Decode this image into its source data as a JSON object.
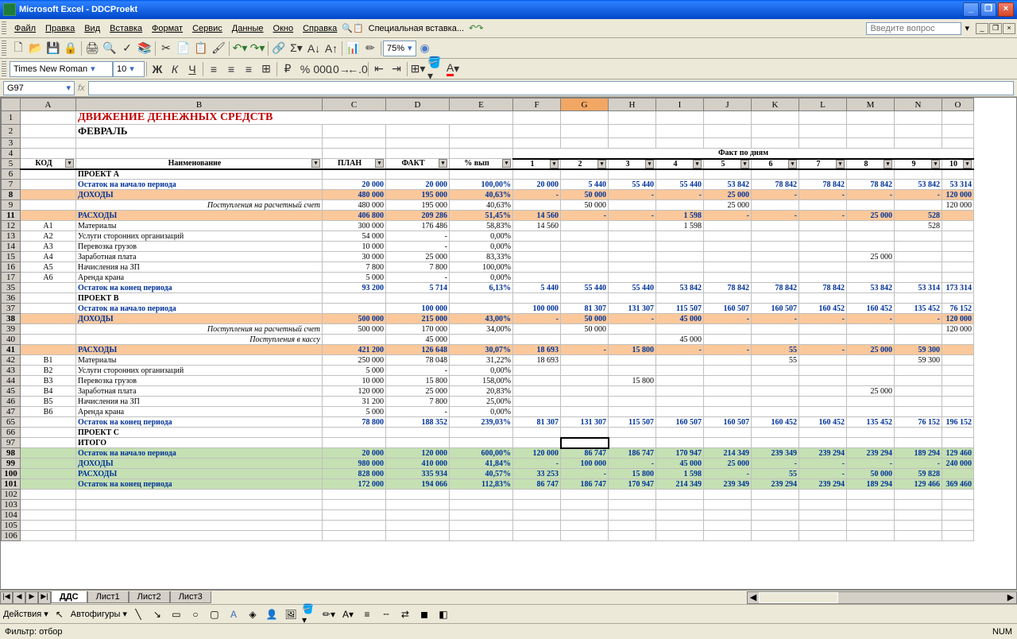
{
  "app": {
    "title": "Microsoft Excel - DDCProekt"
  },
  "menu": {
    "items": [
      "Файл",
      "Правка",
      "Вид",
      "Вставка",
      "Формат",
      "Сервис",
      "Данные",
      "Окно",
      "Справка"
    ],
    "extra": "Специальная вставка...",
    "help_placeholder": "Введите вопрос"
  },
  "font": {
    "name": "Times New Roman",
    "size": "10"
  },
  "zoom": "75%",
  "namebox": "G97",
  "cols": [
    "A",
    "B",
    "C",
    "D",
    "E",
    "F",
    "G",
    "H",
    "I",
    "J",
    "K",
    "L",
    "M",
    "N",
    "O"
  ],
  "doc": {
    "title": "ДВИЖЕНИЕ ДЕНЕЖНЫХ СРЕДСТВ",
    "month": "ФЕВРАЛЬ",
    "fakt_header": "Факт по дням",
    "hdr": {
      "code": "КОД",
      "name": "Наименование",
      "plan": "ПЛАН",
      "fact": "ФАКТ",
      "pct": "% вып"
    },
    "days": [
      "1",
      "2",
      "3",
      "4",
      "5",
      "6",
      "7",
      "8",
      "9",
      "10"
    ]
  },
  "rows": [
    {
      "n": "6",
      "type": "section",
      "label": "ПРОЕКТ А"
    },
    {
      "n": "7",
      "type": "blue",
      "label": "Остаток на начало периода",
      "c": "20 000",
      "d": "20 000",
      "e": "100,00%",
      "f": "20 000",
      "g": "5 440",
      "h": "55 440",
      "i": "55 440",
      "j": "53 842",
      "k": "78 842",
      "l": "78 842",
      "m": "78 842",
      "n2": "53 842",
      "o": "53 314"
    },
    {
      "n": "8",
      "type": "orange",
      "label": "ДОХОДЫ",
      "c": "480 000",
      "d": "195 000",
      "e": "40,63%",
      "f": "-",
      "g": "50 000",
      "h": "-",
      "i": "-",
      "j": "25 000",
      "k": "-",
      "l": "-",
      "m": "-",
      "n2": "-",
      "o": "120 000"
    },
    {
      "n": "9",
      "type": "italic",
      "label": "Поступления на расчетный счет",
      "c": "480 000",
      "d": "195 000",
      "e": "40,63%",
      "g": "50 000",
      "j": "25 000",
      "o": "120 000"
    },
    {
      "n": "11",
      "type": "orange",
      "label": "РАСХОДЫ",
      "c": "406 800",
      "d": "209 286",
      "e": "51,45%",
      "f": "14 560",
      "g": "-",
      "h": "-",
      "i": "1 598",
      "j": "-",
      "k": "-",
      "l": "-",
      "m": "25 000",
      "n2": "528"
    },
    {
      "n": "12",
      "code": "А1",
      "label": "Материалы",
      "c": "300 000",
      "d": "176 486",
      "e": "58,83%",
      "f": "14 560",
      "i": "1 598",
      "n2": "528"
    },
    {
      "n": "13",
      "code": "А2",
      "label": "Услуги сторонних организаций",
      "c": "54 000",
      "d": "-",
      "e": "0,00%"
    },
    {
      "n": "14",
      "code": "А3",
      "label": "Перевозка грузов",
      "c": "10 000",
      "d": "-",
      "e": "0,00%"
    },
    {
      "n": "15",
      "code": "А4",
      "label": "Заработная плата",
      "c": "30 000",
      "d": "25 000",
      "e": "83,33%",
      "m": "25 000"
    },
    {
      "n": "16",
      "code": "А5",
      "label": "Начисления на ЗП",
      "c": "7 800",
      "d": "7 800",
      "e": "100,00%"
    },
    {
      "n": "17",
      "code": "А6",
      "label": "Аренда крана",
      "c": "5 000",
      "d": "-",
      "e": "0,00%"
    },
    {
      "n": "35",
      "type": "blue",
      "label": "Остаток на конец периода",
      "c": "93 200",
      "d": "5 714",
      "e": "6,13%",
      "f": "5 440",
      "g": "55 440",
      "h": "55 440",
      "i": "53 842",
      "j": "78 842",
      "k": "78 842",
      "l": "78 842",
      "m": "53 842",
      "n2": "53 314",
      "o": "173 314"
    },
    {
      "n": "36",
      "type": "section",
      "label": "ПРОЕКТ В"
    },
    {
      "n": "37",
      "type": "blue",
      "label": "Остаток на начало периода",
      "d": "100 000",
      "f": "100 000",
      "g": "81 307",
      "h": "131 307",
      "i": "115 507",
      "j": "160 507",
      "k": "160 507",
      "l": "160 452",
      "m": "160 452",
      "n2": "135 452",
      "o": "76 152"
    },
    {
      "n": "38",
      "type": "orange",
      "label": "ДОХОДЫ",
      "c": "500 000",
      "d": "215 000",
      "e": "43,00%",
      "f": "-",
      "g": "50 000",
      "h": "-",
      "i": "45 000",
      "j": "-",
      "k": "-",
      "l": "-",
      "m": "-",
      "n2": "-",
      "o": "120 000"
    },
    {
      "n": "39",
      "type": "italic",
      "label": "Поступления на расчетный счет",
      "c": "500 000",
      "d": "170 000",
      "e": "34,00%",
      "g": "50 000",
      "o": "120 000"
    },
    {
      "n": "40",
      "type": "italic",
      "label": "Поступления в кассу",
      "d": "45 000",
      "i": "45 000"
    },
    {
      "n": "41",
      "type": "orange",
      "label": "РАСХОДЫ",
      "c": "421 200",
      "d": "126 648",
      "e": "30,07%",
      "f": "18 693",
      "g": "-",
      "h": "15 800",
      "i": "-",
      "j": "-",
      "k": "55",
      "l": "-",
      "m": "25 000",
      "n2": "59 300"
    },
    {
      "n": "42",
      "code": "В1",
      "label": "Материалы",
      "c": "250 000",
      "d": "78 048",
      "e": "31,22%",
      "f": "18 693",
      "k": "55",
      "n2": "59 300"
    },
    {
      "n": "43",
      "code": "В2",
      "label": "Услуги сторонних организаций",
      "c": "5 000",
      "d": "-",
      "e": "0,00%"
    },
    {
      "n": "44",
      "code": "В3",
      "label": "Перевозка грузов",
      "c": "10 000",
      "d": "15 800",
      "e": "158,00%",
      "h": "15 800"
    },
    {
      "n": "45",
      "code": "В4",
      "label": "Заработная плата",
      "c": "120 000",
      "d": "25 000",
      "e": "20,83%",
      "m": "25 000"
    },
    {
      "n": "46",
      "code": "В5",
      "label": "Начисления на ЗП",
      "c": "31 200",
      "d": "7 800",
      "e": "25,00%"
    },
    {
      "n": "47",
      "code": "В6",
      "label": "Аренда крана",
      "c": "5 000",
      "d": "-",
      "e": "0,00%"
    },
    {
      "n": "65",
      "type": "blue",
      "label": "Остаток на конец периода",
      "c": "78 800",
      "d": "188 352",
      "e": "239,03%",
      "f": "81 307",
      "g": "131 307",
      "h": "115 507",
      "i": "160 507",
      "j": "160 507",
      "k": "160 452",
      "l": "160 452",
      "m": "135 452",
      "n2": "76 152",
      "o": "196 152"
    },
    {
      "n": "66",
      "type": "section",
      "label": "ПРОЕКТ С"
    },
    {
      "n": "97",
      "type": "section",
      "label": "ИТОГО",
      "selected": true
    },
    {
      "n": "98",
      "type": "green",
      "label": "Остаток на начало периода",
      "c": "20 000",
      "d": "120 000",
      "e": "600,00%",
      "f": "120 000",
      "g": "86 747",
      "h": "186 747",
      "i": "170 947",
      "j": "214 349",
      "k": "239 349",
      "l": "239 294",
      "m": "239 294",
      "n2": "189 294",
      "o": "129 460"
    },
    {
      "n": "99",
      "type": "green",
      "label": "ДОХОДЫ",
      "c": "980 000",
      "d": "410 000",
      "e": "41,84%",
      "f": "-",
      "g": "100 000",
      "h": "-",
      "i": "45 000",
      "j": "25 000",
      "k": "-",
      "l": "-",
      "m": "-",
      "n2": "-",
      "o": "240 000"
    },
    {
      "n": "100",
      "type": "green",
      "label": "РАСХОДЫ",
      "c": "828 000",
      "d": "335 934",
      "e": "40,57%",
      "f": "33 253",
      "g": "-",
      "h": "15 800",
      "i": "1 598",
      "j": "-",
      "k": "55",
      "l": "-",
      "m": "50 000",
      "n2": "59 828"
    },
    {
      "n": "101",
      "type": "green",
      "label": "Остаток на конец периода",
      "c": "172 000",
      "d": "194 066",
      "e": "112,83%",
      "f": "86 747",
      "g": "186 747",
      "h": "170 947",
      "i": "214 349",
      "j": "239 349",
      "k": "239 294",
      "l": "239 294",
      "m": "189 294",
      "n2": "129 466",
      "o": "369 460"
    },
    {
      "n": "102"
    },
    {
      "n": "103"
    },
    {
      "n": "104"
    },
    {
      "n": "105"
    },
    {
      "n": "106"
    }
  ],
  "tabs": {
    "active": "ДДС",
    "others": [
      "Лист1",
      "Лист2",
      "Лист3"
    ]
  },
  "drawing": {
    "actions": "Действия",
    "shapes": "Автофигуры"
  },
  "status": {
    "filter": "Фильтр: отбор",
    "num": "NUM"
  }
}
